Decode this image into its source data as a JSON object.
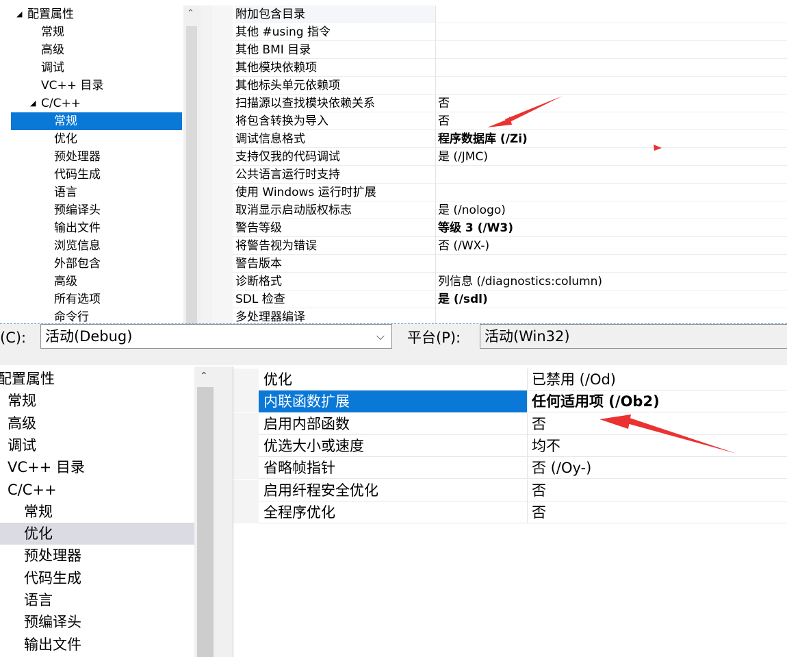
{
  "top": {
    "tree": [
      {
        "label": "配置属性",
        "level": 0,
        "expander": "◢",
        "selected": false
      },
      {
        "label": "常规",
        "level": 1,
        "selected": false
      },
      {
        "label": "高级",
        "level": 1,
        "selected": false
      },
      {
        "label": "调试",
        "level": 1,
        "selected": false
      },
      {
        "label": "VC++ 目录",
        "level": 1,
        "selected": false
      },
      {
        "label": "C/C++",
        "level": 1,
        "expander": "◢",
        "selected": false
      },
      {
        "label": "常规",
        "level": 2,
        "selected": true
      },
      {
        "label": "优化",
        "level": 2,
        "selected": false
      },
      {
        "label": "预处理器",
        "level": 2,
        "selected": false
      },
      {
        "label": "代码生成",
        "level": 2,
        "selected": false
      },
      {
        "label": "语言",
        "level": 2,
        "selected": false
      },
      {
        "label": "预编译头",
        "level": 2,
        "selected": false
      },
      {
        "label": "输出文件",
        "level": 2,
        "selected": false
      },
      {
        "label": "浏览信息",
        "level": 2,
        "selected": false
      },
      {
        "label": "外部包含",
        "level": 2,
        "selected": false
      },
      {
        "label": "高级",
        "level": 2,
        "selected": false
      },
      {
        "label": "所有选项",
        "level": 2,
        "selected": false
      },
      {
        "label": "命令行",
        "level": 2,
        "selected": false
      }
    ],
    "scroll_up_glyph": "⌃",
    "properties": [
      {
        "name": "附加包含目录",
        "value": "",
        "bold": false
      },
      {
        "name": "其他 #using 指令",
        "value": "",
        "bold": false
      },
      {
        "name": "其他 BMI 目录",
        "value": "",
        "bold": false
      },
      {
        "name": "其他模块依赖项",
        "value": "",
        "bold": false
      },
      {
        "name": "其他标头单元依赖项",
        "value": "",
        "bold": false
      },
      {
        "name": "扫描源以查找模块依赖关系",
        "value": "否",
        "bold": false
      },
      {
        "name": "将包含转换为导入",
        "value": "否",
        "bold": false
      },
      {
        "name": "调试信息格式",
        "value": "程序数据库 (/Zi)",
        "bold": true
      },
      {
        "name": "支持仅我的代码调试",
        "value": "是 (/JMC)",
        "bold": false
      },
      {
        "name": "公共语言运行时支持",
        "value": "",
        "bold": false
      },
      {
        "name": "使用 Windows 运行时扩展",
        "value": "",
        "bold": false
      },
      {
        "name": "取消显示启动版权标志",
        "value": "是 (/nologo)",
        "bold": false
      },
      {
        "name": "警告等级",
        "value": "等级 3 (/W3)",
        "bold": true
      },
      {
        "name": "将警告视为错误",
        "value": "否 (/WX-)",
        "bold": false
      },
      {
        "name": "警告版本",
        "value": "",
        "bold": false
      },
      {
        "name": "诊断格式",
        "value": "列信息 (/diagnostics:column)",
        "bold": false
      },
      {
        "name": "SDL 检查",
        "value": "是 (/sdl)",
        "bold": true
      },
      {
        "name": "多处理器编译",
        "value": "",
        "bold": false
      }
    ]
  },
  "config_bar": {
    "config_label": "(C):",
    "config_value": "活动(Debug)",
    "platform_label": "平台(P):",
    "platform_value": "活动(Win32)",
    "dropdown_glyph": "⌵"
  },
  "bottom": {
    "tree": [
      {
        "label": "配置属性",
        "level": 0,
        "state": ""
      },
      {
        "label": "常规",
        "level": 1,
        "state": ""
      },
      {
        "label": "高级",
        "level": 1,
        "state": ""
      },
      {
        "label": "调试",
        "level": 1,
        "state": ""
      },
      {
        "label": "VC++ 目录",
        "level": 1,
        "state": ""
      },
      {
        "label": "C/C++",
        "level": 1,
        "state": ""
      },
      {
        "label": "常规",
        "level": 2,
        "state": ""
      },
      {
        "label": "优化",
        "level": 2,
        "state": "selected"
      },
      {
        "label": "预处理器",
        "level": 2,
        "state": ""
      },
      {
        "label": "代码生成",
        "level": 2,
        "state": ""
      },
      {
        "label": "语言",
        "level": 2,
        "state": ""
      },
      {
        "label": "预编译头",
        "level": 2,
        "state": ""
      },
      {
        "label": "输出文件",
        "level": 2,
        "state": ""
      }
    ],
    "scroll_up_glyph": "⌃",
    "properties": [
      {
        "name": "优化",
        "value": "已禁用 (/Od)",
        "bold": false,
        "selected": false
      },
      {
        "name": "内联函数扩展",
        "value": "任何适用项 (/Ob2)",
        "bold": true,
        "selected": true
      },
      {
        "name": "启用内部函数",
        "value": "否",
        "bold": false,
        "selected": false
      },
      {
        "name": "优选大小或速度",
        "value": "均不",
        "bold": false,
        "selected": false
      },
      {
        "name": "省略帧指针",
        "value": "否 (/Oy-)",
        "bold": false,
        "selected": false
      },
      {
        "name": "启用纤程安全优化",
        "value": "否",
        "bold": false,
        "selected": false
      },
      {
        "name": "全程序优化",
        "value": "否",
        "bold": false,
        "selected": false
      }
    ]
  },
  "annotation_color": "#ea3232"
}
